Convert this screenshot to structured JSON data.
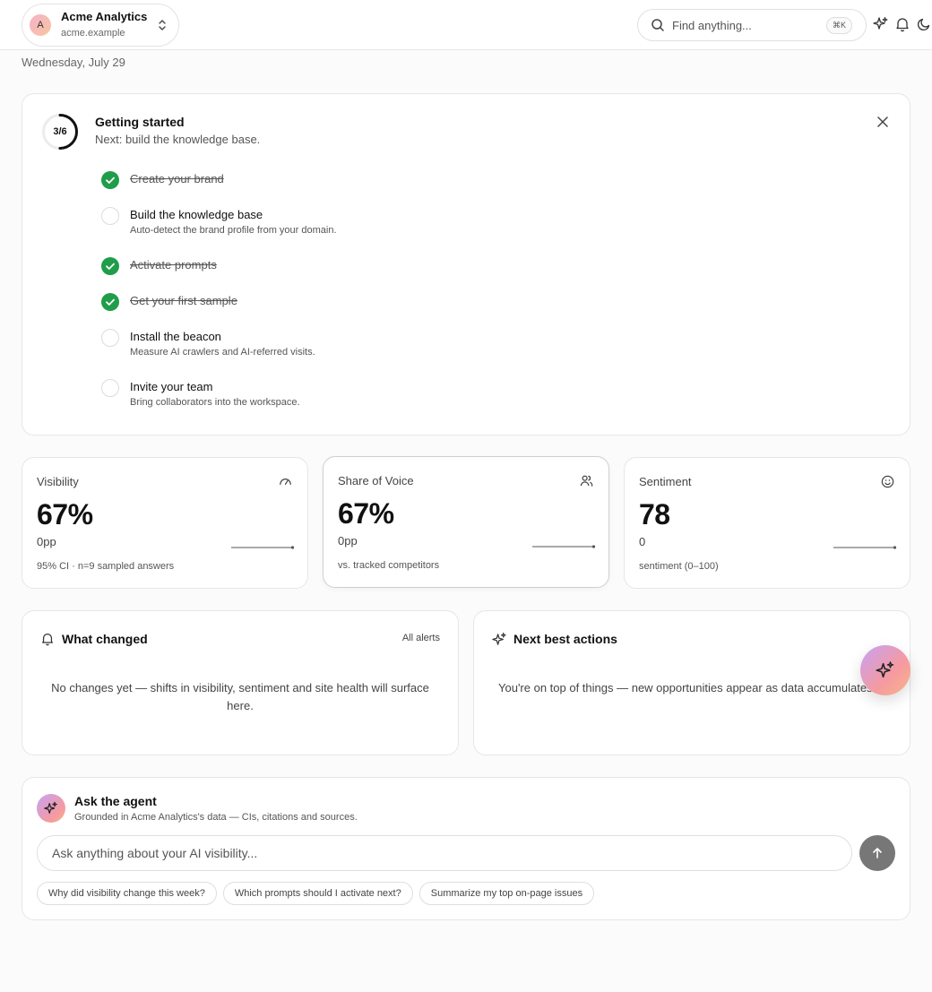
{
  "workspace": {
    "initial": "A",
    "name": "Acme Analytics",
    "domain": "acme.example"
  },
  "search": {
    "placeholder": "Find anything...",
    "shortcut": "⌘K"
  },
  "date": "Wednesday, July 29",
  "getting_started": {
    "progress_label": "3/6",
    "progress_fraction": 0.5,
    "title": "Getting started",
    "subtitle": "Next: build the knowledge base.",
    "steps": [
      {
        "label": "Create your brand",
        "done": true
      },
      {
        "label": "Build the knowledge base",
        "description": "Auto-detect the brand profile from your domain.",
        "done": false
      },
      {
        "label": "Activate prompts",
        "done": true
      },
      {
        "label": "Get your first sample",
        "done": true
      },
      {
        "label": "Install the beacon",
        "description": "Measure AI crawlers and AI-referred visits.",
        "done": false
      },
      {
        "label": "Invite your team",
        "description": "Bring collaborators into the workspace.",
        "done": false
      }
    ]
  },
  "metrics": [
    {
      "title": "Visibility",
      "icon": "gauge-icon",
      "value": "67%",
      "delta": "0pp",
      "footnote": "95% CI · n=9 sampled answers"
    },
    {
      "title": "Share of Voice",
      "icon": "users-icon",
      "value": "67%",
      "delta": "0pp",
      "footnote": "vs. tracked competitors"
    },
    {
      "title": "Sentiment",
      "icon": "smile-icon",
      "value": "78",
      "delta": "0",
      "footnote": "sentiment (0–100)"
    }
  ],
  "what_changed": {
    "title": "What changed",
    "link": "All alerts",
    "empty": "No changes yet — shifts in visibility, sentiment and site health will surface here."
  },
  "next_actions": {
    "title": "Next best actions",
    "empty": "You're on top of things — new opportunities appear as data accumulates."
  },
  "agent": {
    "title": "Ask the agent",
    "subtitle": "Grounded in Acme Analytics's data — CIs, citations and sources.",
    "placeholder": "Ask anything about your AI visibility...",
    "suggestions": [
      "Why did visibility change this week?",
      "Which prompts should I activate next?",
      "Summarize my top on-page issues"
    ]
  },
  "colors": {
    "check": "#1f9d4a",
    "send": "#777777"
  }
}
